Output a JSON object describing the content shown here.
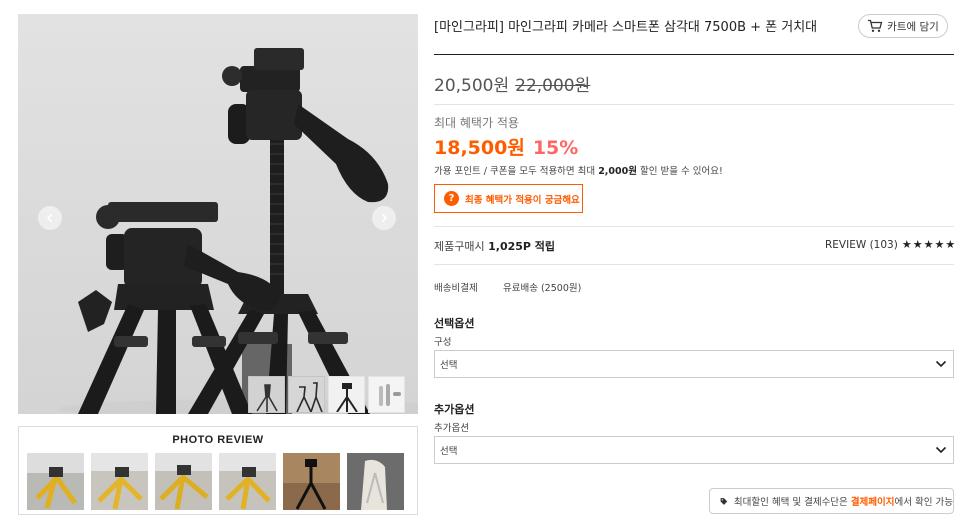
{
  "gallery": {
    "prev_icon": "chevron-left-icon",
    "next_icon": "chevron-right-icon",
    "thumbnail_count": 4
  },
  "photo_review": {
    "title": "PHOTO REVIEW",
    "photo_count": 6
  },
  "product": {
    "title": "[마인그라피] 마인그라피 카메라 스마트폰 삼각대 7500B + 폰 거치대",
    "cart_label": "카트에 담기",
    "cart_icon": "cart-icon",
    "price": "20,500원",
    "original_price": "22,000원"
  },
  "benefit": {
    "label": "최대 혜택가 적용",
    "price": "18,500원",
    "discount": "15%",
    "note_before": "가용 포인트 / 쿠폰을 모두 적용하면 최대 ",
    "note_amount": "2,000원",
    "note_after": " 할인 받을 수 있어요!",
    "button_label": "최종 혜택가 적용이 궁금해요",
    "button_icon": "question-circle-icon"
  },
  "points": {
    "label": "제품구매시 ",
    "value": "1,025P 적립"
  },
  "review": {
    "label": "REVIEW (103)",
    "stars": [
      "★",
      "★",
      "★",
      "★",
      "★"
    ]
  },
  "shipping": {
    "label": "배송비결제",
    "value": "유료배송 (2500원)"
  },
  "options": {
    "select_title": "선택옵션",
    "select_sub": "구성",
    "select_value": "선택",
    "extra_title": "추가옵션",
    "extra_sub": "추가옵션",
    "extra_value": "선택"
  },
  "payment_note": {
    "icon": "tag-icon",
    "before": "최대할인 혜택 및 결제수단은 ",
    "highlight": "결제페이지",
    "after": "에서 확인 가능"
  },
  "colors": {
    "accent": "#ff5c00",
    "discount": "#ff6666"
  }
}
